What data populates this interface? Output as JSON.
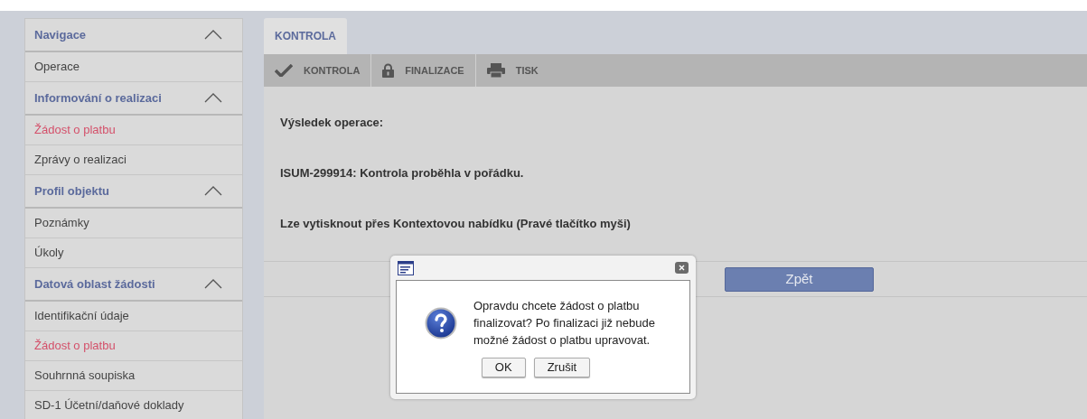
{
  "sidebar": {
    "sections": [
      {
        "title": "Navigace",
        "expanded": true,
        "items": [
          {
            "label": "Operace",
            "selected": false
          }
        ]
      },
      {
        "title": "Informování o realizaci",
        "expanded": true,
        "items": [
          {
            "label": "Žádost o platbu",
            "selected": true
          },
          {
            "label": "Zprávy o realizaci",
            "selected": false
          }
        ]
      },
      {
        "title": "Profil objektu",
        "expanded": true,
        "items": [
          {
            "label": "Poznámky",
            "selected": false
          },
          {
            "label": "Úkoly",
            "selected": false
          }
        ]
      },
      {
        "title": "Datová oblast žádosti",
        "expanded": true,
        "items": [
          {
            "label": "Identifikační údaje",
            "selected": false
          },
          {
            "label": "Žádost o platbu",
            "selected": true
          },
          {
            "label": "Souhrnná soupiska",
            "selected": false
          },
          {
            "label": "SD-1 Účetní/daňové doklady",
            "selected": false
          }
        ]
      }
    ]
  },
  "tabs": [
    {
      "label": "KONTROLA",
      "selected": true
    }
  ],
  "toolbar": [
    {
      "kind": "check",
      "label": "KONTROLA"
    },
    {
      "kind": "lock",
      "label": "FINALIZACE"
    },
    {
      "kind": "print",
      "label": "TISK"
    }
  ],
  "content": {
    "lines": [
      "Výsledek operace:",
      "ISUM-299914: Kontrola proběhla v pořádku.",
      "Lze vytisknout přes Kontextovou nabídku (Pravé tlačítko myši)"
    ],
    "back_button": "Zpět"
  },
  "dialog": {
    "message": "Opravdu chcete žádost o platbu finalizovat? Po finalizaci již nebude možné žádost o platbu upravovat.",
    "buttons": [
      "OK",
      "Zrušit"
    ]
  }
}
